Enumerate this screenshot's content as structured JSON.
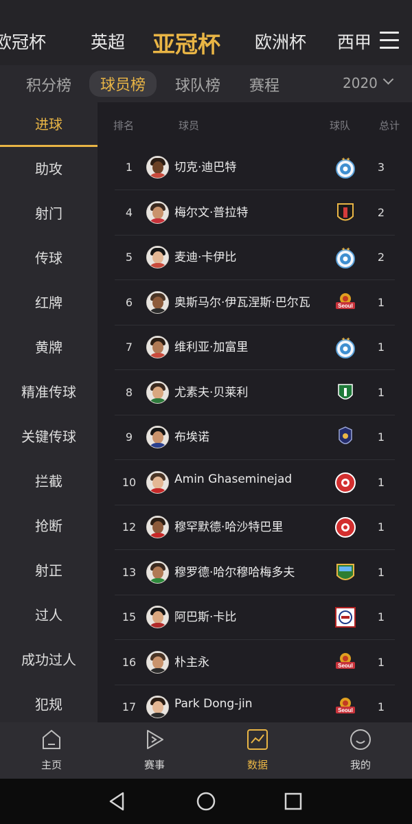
{
  "top_nav": {
    "tabs": [
      "欧冠杯",
      "英超",
      "亚冠杯",
      "欧洲杯",
      "西甲"
    ],
    "active_tab": "亚冠杯",
    "menu_icon": "hamburger-menu-icon"
  },
  "sub_tabs": {
    "items": [
      "积分榜",
      "球员榜",
      "球队榜",
      "赛程"
    ],
    "active": "球员榜",
    "season": "2020",
    "season_icon": "chevron-down-icon"
  },
  "sidebar": {
    "items": [
      "进球",
      "助攻",
      "射门",
      "传球",
      "红牌",
      "黄牌",
      "精准传球",
      "关键传球",
      "拦截",
      "抢断",
      "射正",
      "过人",
      "成功过人",
      "犯规"
    ],
    "active": "进球"
  },
  "table": {
    "headers": {
      "rank": "排名",
      "player": "球员",
      "team": "球队",
      "total": "总计"
    },
    "rows": [
      {
        "rank": "1",
        "name": "切克·迪巴特",
        "total": "3",
        "team_icon": "al-duhail-badge-icon"
      },
      {
        "rank": "4",
        "name": "梅尔文·普拉特",
        "total": "2",
        "team_icon": "bali-united-badge-icon"
      },
      {
        "rank": "5",
        "name": "麦迪·卡伊比",
        "total": "2",
        "team_icon": "al-duhail-badge-icon"
      },
      {
        "rank": "6",
        "name": "奥斯马尔·伊瓦涅斯·巴尔瓦",
        "total": "1",
        "team_icon": "fc-seoul-badge-icon"
      },
      {
        "rank": "7",
        "name": "维利亚·加富里",
        "total": "1",
        "team_icon": "al-duhail-badge-icon"
      },
      {
        "rank": "8",
        "name": "尤素夫·贝莱利",
        "total": "1",
        "team_icon": "al-ahli-badge-icon"
      },
      {
        "rank": "9",
        "name": "布埃诺",
        "total": "1",
        "team_icon": "buriram-united-badge-icon"
      },
      {
        "rank": "10",
        "name": "Amin Ghaseminejad",
        "total": "1",
        "team_icon": "persepolis-badge-icon"
      },
      {
        "rank": "12",
        "name": "穆罕默德·哈沙特巴里",
        "total": "1",
        "team_icon": "persepolis-badge-icon"
      },
      {
        "rank": "13",
        "name": "穆罗德·哈尔穆哈梅多夫",
        "total": "1",
        "team_icon": "pakhtakor-badge-icon"
      },
      {
        "rank": "15",
        "name": "阿巴斯·卡比",
        "total": "1",
        "team_icon": "sharjah-badge-icon"
      },
      {
        "rank": "16",
        "name": "朴主永",
        "total": "1",
        "team_icon": "fc-seoul-badge-icon"
      },
      {
        "rank": "17",
        "name": "Park Dong-jin",
        "total": "1",
        "team_icon": "fc-seoul-badge-icon"
      }
    ]
  },
  "bottom_nav": {
    "items": [
      {
        "label": "主页",
        "icon": "home-icon"
      },
      {
        "label": "赛事",
        "icon": "play-icon"
      },
      {
        "label": "数据",
        "icon": "chart-icon"
      },
      {
        "label": "我的",
        "icon": "profile-icon"
      }
    ],
    "active": "数据"
  },
  "system_nav": {
    "icons": [
      "back-icon",
      "home-circle-icon",
      "recents-icon"
    ]
  },
  "colors": {
    "accent": "#e9b545",
    "background": "#1f1e23",
    "sidebar_bg": "#2a292e",
    "text": "#ececec",
    "muted": "#7e7e84"
  }
}
